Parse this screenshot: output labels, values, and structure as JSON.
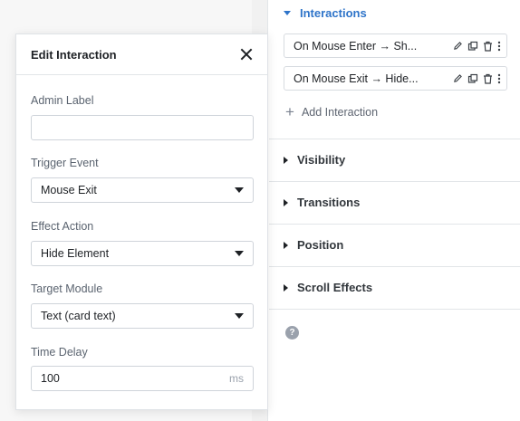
{
  "settings": {
    "interactions_title": "Interactions",
    "items": [
      {
        "label": "On Mouse Enter → Sh..."
      },
      {
        "label": "On Mouse Exit → Hide..."
      }
    ],
    "add_label": "Add Interaction",
    "sections": [
      "Visibility",
      "Transitions",
      "Position",
      "Scroll Effects"
    ],
    "help_glyph": "?"
  },
  "modal": {
    "title": "Edit Interaction",
    "fields": {
      "admin_label": {
        "label": "Admin Label",
        "value": ""
      },
      "trigger": {
        "label": "Trigger Event",
        "value": "Mouse Exit"
      },
      "action": {
        "label": "Effect Action",
        "value": "Hide Element"
      },
      "target": {
        "label": "Target Module",
        "value": "Text (card text)"
      },
      "delay": {
        "label": "Time Delay",
        "value": "100",
        "unit": "ms"
      }
    }
  },
  "colors": {
    "accent": "#2e74c9",
    "text": "#1e2125",
    "muted": "#5b6470",
    "border": "#cfd4da"
  }
}
